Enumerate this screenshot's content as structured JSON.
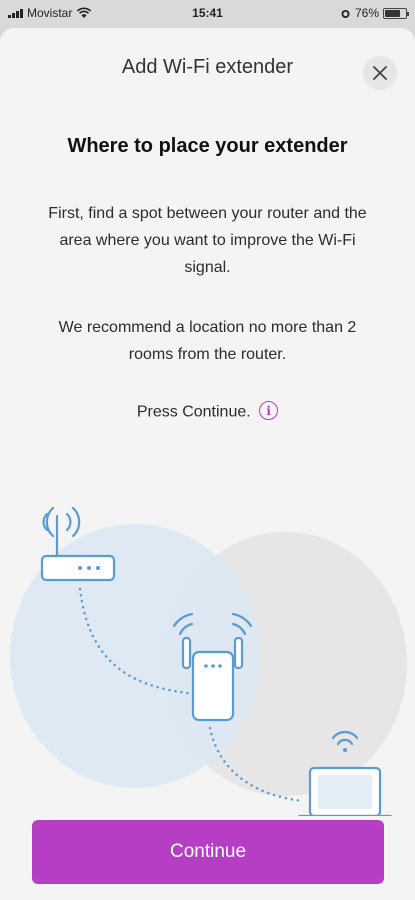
{
  "status_bar": {
    "carrier": "Movistar",
    "time": "15:41",
    "battery": "76%",
    "battery_level": 0.76
  },
  "header": {
    "title": "Add Wi-Fi extender",
    "close_icon": "close-icon"
  },
  "main": {
    "heading": "Where to place your extender",
    "paragraph1": "First, find a spot between your router and the area where you want to improve the Wi-Fi signal.",
    "paragraph2": "We recommend a location no more than 2 rooms from the router.",
    "press_text": "Press Continue.",
    "info_icon_label": "i"
  },
  "illustration": {
    "icons": [
      "router-icon",
      "extender-icon",
      "laptop-icon",
      "wifi-signal-icon"
    ]
  },
  "footer": {
    "continue_label": "Continue"
  },
  "colors": {
    "accent": "#B53EC4",
    "illustration": "#5B9BD5",
    "sheet_bg": "#F4F4F4"
  }
}
